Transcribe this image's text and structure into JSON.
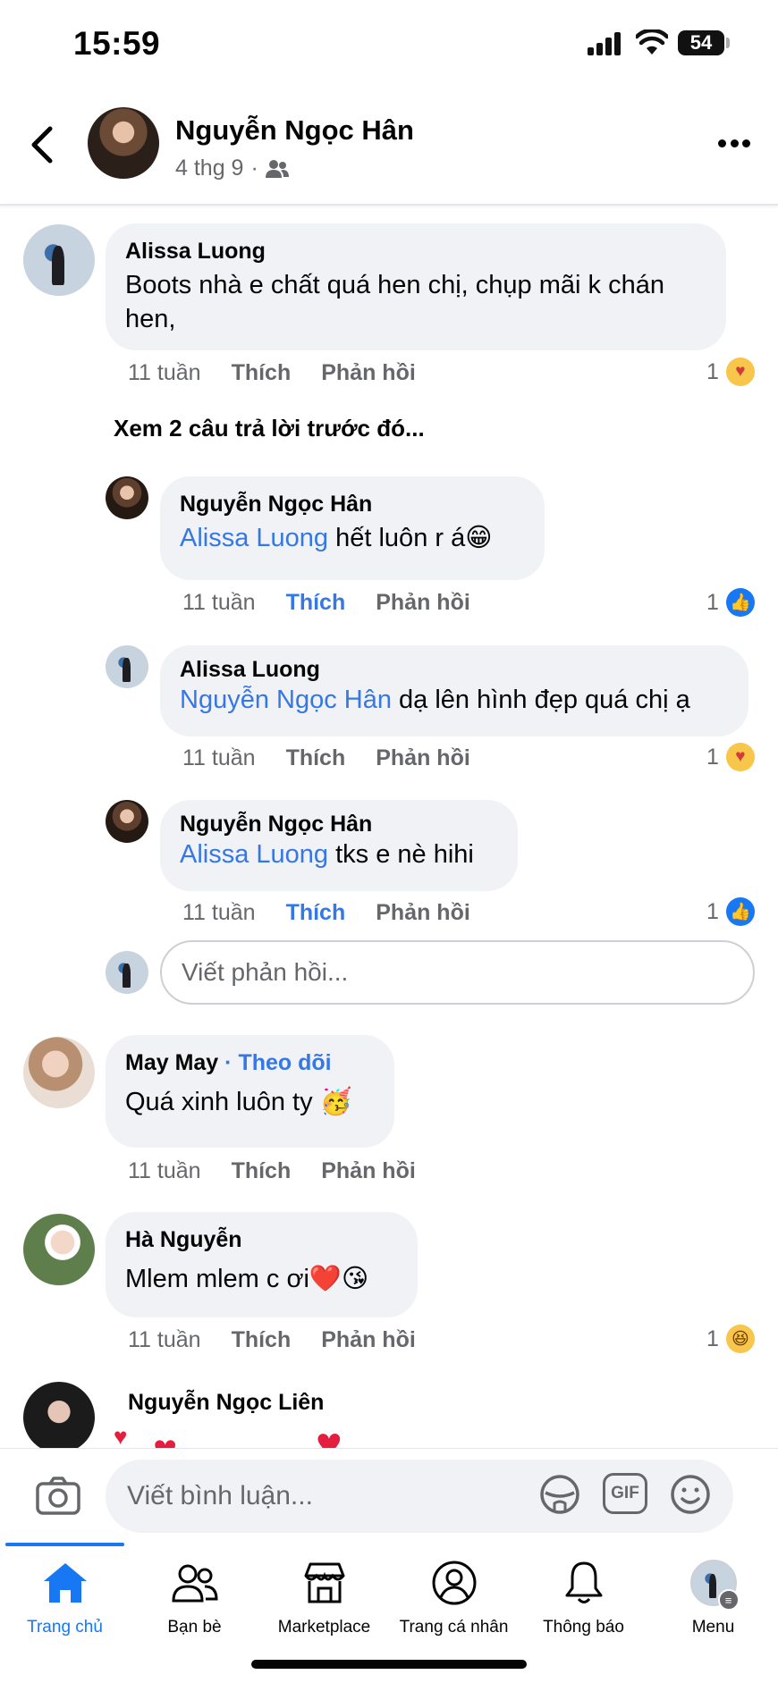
{
  "status_bar": {
    "time": "15:59",
    "battery": "54"
  },
  "post": {
    "author": "Nguyễn Ngọc Hân",
    "date": "4 thg 9",
    "separator": "·"
  },
  "comments": [
    {
      "author": "Alissa Luong",
      "text": "Boots nhà e chất quá hen chị, chụp mãi k chán hen,",
      "time": "11 tuần",
      "like": "Thích",
      "reply": "Phản hồi",
      "reaction_count": "1",
      "reaction": "care"
    }
  ],
  "view_previous": "Xem 2 câu trả lời trước đó...",
  "replies": [
    {
      "author": "Nguyễn Ngọc Hân",
      "mention": "Alissa Luong",
      "text": " hết luôn r á😁",
      "time": "11 tuần",
      "like": "Thích",
      "reply": "Phản hồi",
      "reaction_count": "1",
      "reaction": "like",
      "liked": true
    },
    {
      "author": "Alissa Luong",
      "mention": "Nguyễn Ngọc Hân",
      "text": " dạ lên hình đẹp quá chị ạ",
      "time": "11 tuần",
      "like": "Thích",
      "reply": "Phản hồi",
      "reaction_count": "1",
      "reaction": "care",
      "liked": false
    },
    {
      "author": "Nguyễn Ngọc Hân",
      "mention": "Alissa Luong",
      "text": " tks e nè hihi",
      "time": "11 tuần",
      "like": "Thích",
      "reply": "Phản hồi",
      "reaction_count": "1",
      "reaction": "like",
      "liked": true
    }
  ],
  "reply_placeholder": "Viết phản hồi...",
  "more_comments": [
    {
      "author": "May May",
      "follow": "· Theo dõi",
      "text": "Quá xinh luôn ty 🥳",
      "time": "11 tuần",
      "like": "Thích",
      "reply": "Phản hồi"
    },
    {
      "author": "Hà Nguyễn",
      "text": "Mlem mlem c ơi❤️😘",
      "time": "11 tuần",
      "like": "Thích",
      "reply": "Phản hồi",
      "reaction_count": "1",
      "reaction": "haha"
    },
    {
      "author": "Nguyễn Ngọc Liên"
    }
  ],
  "composer": {
    "placeholder": "Viết bình luận...",
    "gif": "GIF"
  },
  "tabs": [
    {
      "label": "Trang chủ",
      "icon": "home-icon",
      "active": true
    },
    {
      "label": "Bạn bè",
      "icon": "friends-icon"
    },
    {
      "label": "Marketplace",
      "icon": "marketplace-icon"
    },
    {
      "label": "Trang cá nhân",
      "icon": "profile-icon"
    },
    {
      "label": "Thông báo",
      "icon": "bell-icon"
    },
    {
      "label": "Menu",
      "icon": "menu-avatar-icon"
    }
  ],
  "colors": {
    "accent": "#1877f2",
    "mention": "#3578e5",
    "bubble": "#f0f2f5",
    "secondary_text": "#65676b",
    "heart": "#e41e3f"
  }
}
